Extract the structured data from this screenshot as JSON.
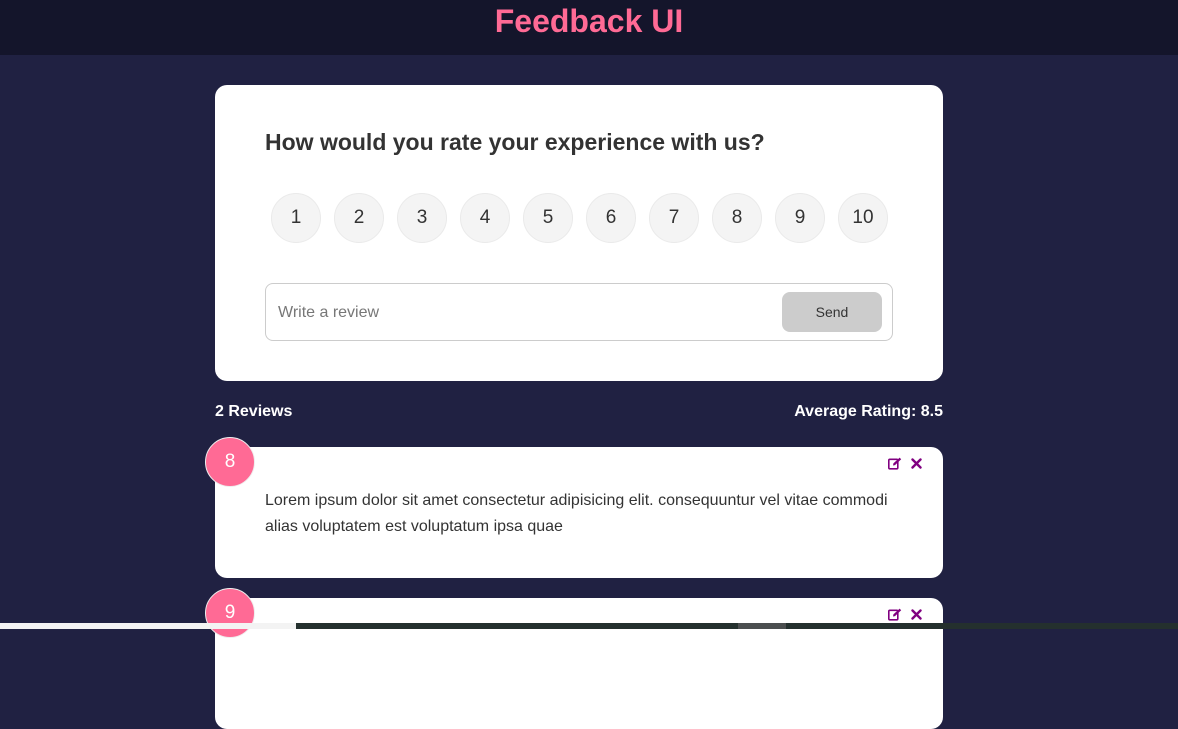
{
  "header": {
    "title": "Feedback UI"
  },
  "rating_card": {
    "question": "How would you rate your experience with us?",
    "options": [
      "1",
      "2",
      "3",
      "4",
      "5",
      "6",
      "7",
      "8",
      "9",
      "10"
    ],
    "review_placeholder": "Write a review",
    "review_value": "",
    "send_label": "Send"
  },
  "stats": {
    "count_label": "2 Reviews",
    "average_label": "Average Rating: 8.5"
  },
  "reviews": [
    {
      "rating": "8",
      "text": "Lorem ipsum dolor sit amet consectetur adipisicing elit. consequuntur vel vitae commodi alias voluptatem est voluptatum ipsa quae"
    },
    {
      "rating": "9",
      "text": ""
    }
  ],
  "icons": {
    "edit": "edit-icon",
    "delete": "close-icon"
  },
  "colors": {
    "background": "#202142",
    "header": "#14152b",
    "accent": "#ff6a95",
    "icon": "#800080"
  }
}
